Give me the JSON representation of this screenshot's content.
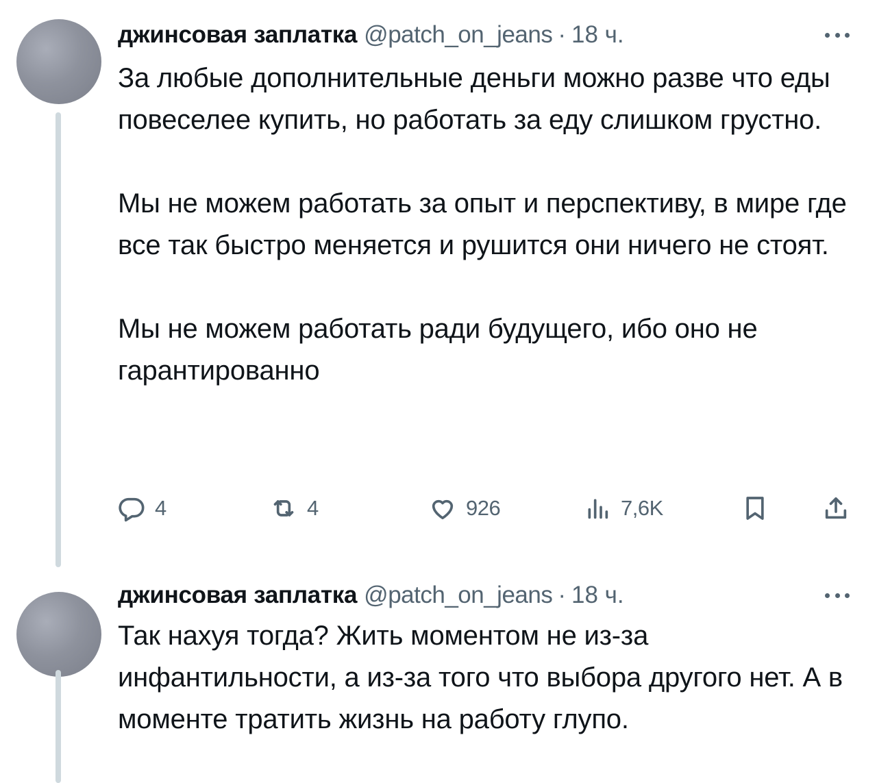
{
  "tweets": [
    {
      "author_name": "джинсовая заплатка",
      "handle": "@patch_on_jeans",
      "separator": "·",
      "time": "18 ч.",
      "paragraphs": [
        "За любые дополнительные деньги можно разве что еды повеселее купить, но работать за еду слишком грустно.",
        "Мы не можем работать за опыт и перспективу, в мире где все так быстро меняется и рушится они ничего не стоят.",
        "Мы не можем работать ради будущего, ибо оно не гарантированно"
      ],
      "actions": {
        "replies": "4",
        "retweets": "4",
        "likes": "926",
        "views": "7,6K"
      }
    },
    {
      "author_name": "джинсовая заплатка",
      "handle": "@patch_on_jeans",
      "separator": "·",
      "time": "18 ч.",
      "paragraphs": [
        "Так нахуя тогда? Жить моментом не из-за инфантильности, а из-за того что выбора другого нет. А в моменте тратить жизнь на работу глупо."
      ]
    }
  ],
  "icons": {
    "reply": "reply-icon",
    "retweet": "retweet-icon",
    "like": "heart-icon",
    "views": "views-icon",
    "bookmark": "bookmark-icon",
    "share": "share-icon",
    "more": "more-icon"
  },
  "colors": {
    "text": "#0f1419",
    "secondary": "#536471",
    "thread_line": "#cfd9de"
  }
}
